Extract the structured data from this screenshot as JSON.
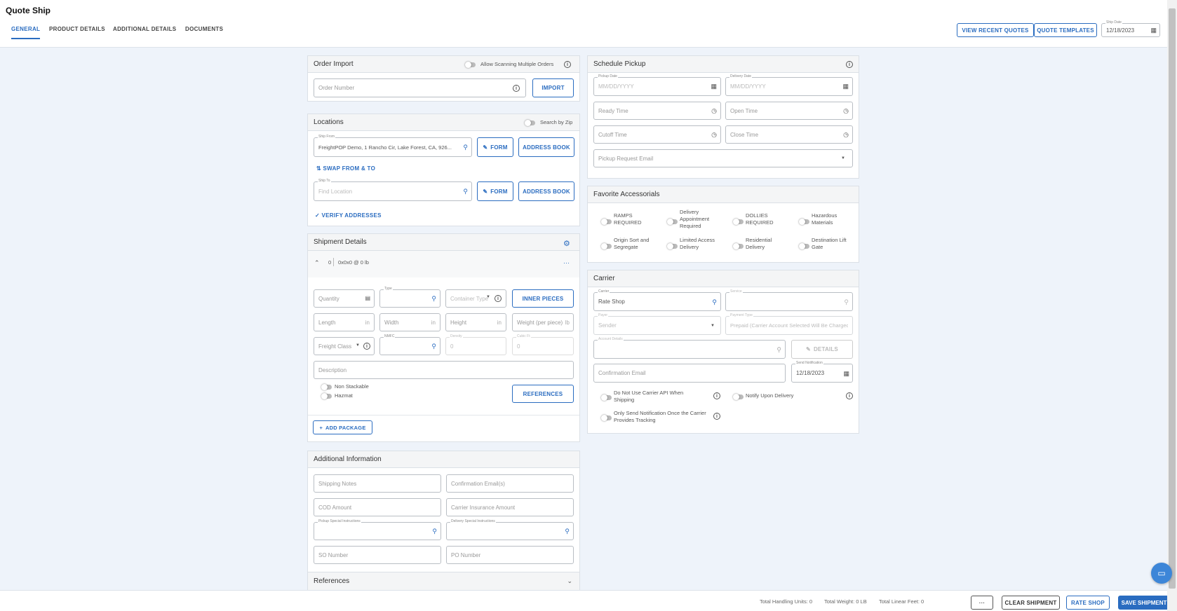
{
  "app": {
    "title": "Quote Ship"
  },
  "tabs": [
    {
      "label": "GENERAL",
      "active": true
    },
    {
      "label": "PRODUCT DETAILS"
    },
    {
      "label": "ADDITIONAL DETAILS"
    },
    {
      "label": "DOCUMENTS"
    }
  ],
  "header": {
    "view_recent_quotes": "VIEW RECENT QUOTES",
    "quote_templates": "QUOTE TEMPLATES",
    "ship_date_label": "Ship Date",
    "ship_date": "12/18/2023"
  },
  "order_import": {
    "title": "Order Import",
    "allow_scanning": "Allow Scanning Multiple Orders",
    "order_number_placeholder": "Order Number",
    "import": "IMPORT"
  },
  "locations": {
    "title": "Locations",
    "search_by_zip": "Search by Zip",
    "ship_from_label": "Ship From",
    "ship_from_value": "FreightPOP Demo, 1 Rancho Cir, Lake Forest, CA, 926...",
    "form": "FORM",
    "address_book": "ADDRESS BOOK",
    "swap": "SWAP FROM & TO",
    "ship_to_label": "Ship To",
    "ship_to_placeholder": "Find Location",
    "verify": "VERIFY ADDRESSES"
  },
  "shipment": {
    "title": "Shipment Details",
    "package_count": "0",
    "package_summary": "0x0x0 @ 0 lb",
    "quantity": "Quantity",
    "type_label": "Type",
    "container_type": "Container Type",
    "inner_pieces": "INNER PIECES",
    "length": "Length",
    "width": "Width",
    "height": "Height",
    "unit_in": "in",
    "weight": "Weight (per piece)",
    "unit_lb": "lb",
    "freight_class": "Freight Class",
    "nmfc_label": "NMFC",
    "density_label": "Density",
    "density_value": "0",
    "cubic_label": "Cubic Ft",
    "cubic_value": "0",
    "description": "Description",
    "non_stackable": "Non Stackable",
    "hazmat": "Hazmat",
    "references": "REFERENCES",
    "add_package": "ADD PACKAGE"
  },
  "additional": {
    "title": "Additional Information",
    "shipping_notes": "Shipping Notes",
    "confirmation_emails": "Confirmation Email(s)",
    "cod_amount": "COD Amount",
    "carrier_insurance": "Carrier Insurance Amount",
    "pickup_special": "Pickup Special Instructions",
    "delivery_special": "Delivery Special Instructions",
    "so_number": "SO Number",
    "po_number": "PO Number"
  },
  "references_section": {
    "title": "References"
  },
  "schedule": {
    "title": "Schedule Pickup",
    "pickup_date_label": "Pickup Date",
    "delivery_date_label": "Delivery Date",
    "date_placeholder": "MM/DD/YYYY",
    "ready_time": "Ready Time",
    "open_time": "Open Time",
    "cutoff_time": "Cutoff Time",
    "close_time": "Close Time",
    "pickup_request_email": "Pickup Request Email"
  },
  "accessorials": {
    "title": "Favorite Accessorials",
    "items": [
      {
        "label": "RAMPS REQUIRED"
      },
      {
        "label": "Delivery Appointment Required"
      },
      {
        "label": "DOLLIES REQUIRED"
      },
      {
        "label": "Hazardous Materials"
      },
      {
        "label": "Origin Sort and Segregate"
      },
      {
        "label": "Limited Access Delivery"
      },
      {
        "label": "Residential Delivery"
      },
      {
        "label": "Destination Lift Gate"
      }
    ]
  },
  "carrier": {
    "title": "Carrier",
    "carrier_label": "Carrier",
    "carrier_value": "Rate Shop",
    "service_label": "Service",
    "payer_label": "Payer",
    "payer_value": "Sender",
    "payment_type_label": "Payment Type",
    "payment_type_value": "Prepaid (Carrier Account Selected Will Be Charged)",
    "account_details_label": "Account Details",
    "details": "DETAILS",
    "confirmation_email": "Confirmation Email",
    "send_notification_label": "Send Notification",
    "send_notification_date": "12/18/2023",
    "no_api": "Do Not Use Carrier API When Shipping",
    "notify_delivery": "Notify Upon Delivery",
    "only_send": "Only Send Notification Once the Carrier Provides Tracking"
  },
  "footer": {
    "handling_units": "Total Handling Units: 0",
    "total_weight": "Total Weight: 0 LB",
    "linear_feet": "Total Linear Feet: 0",
    "more": "···",
    "clear": "CLEAR SHIPMENT",
    "rate_shop": "RATE SHOP",
    "save": "SAVE SHIPMENT"
  }
}
